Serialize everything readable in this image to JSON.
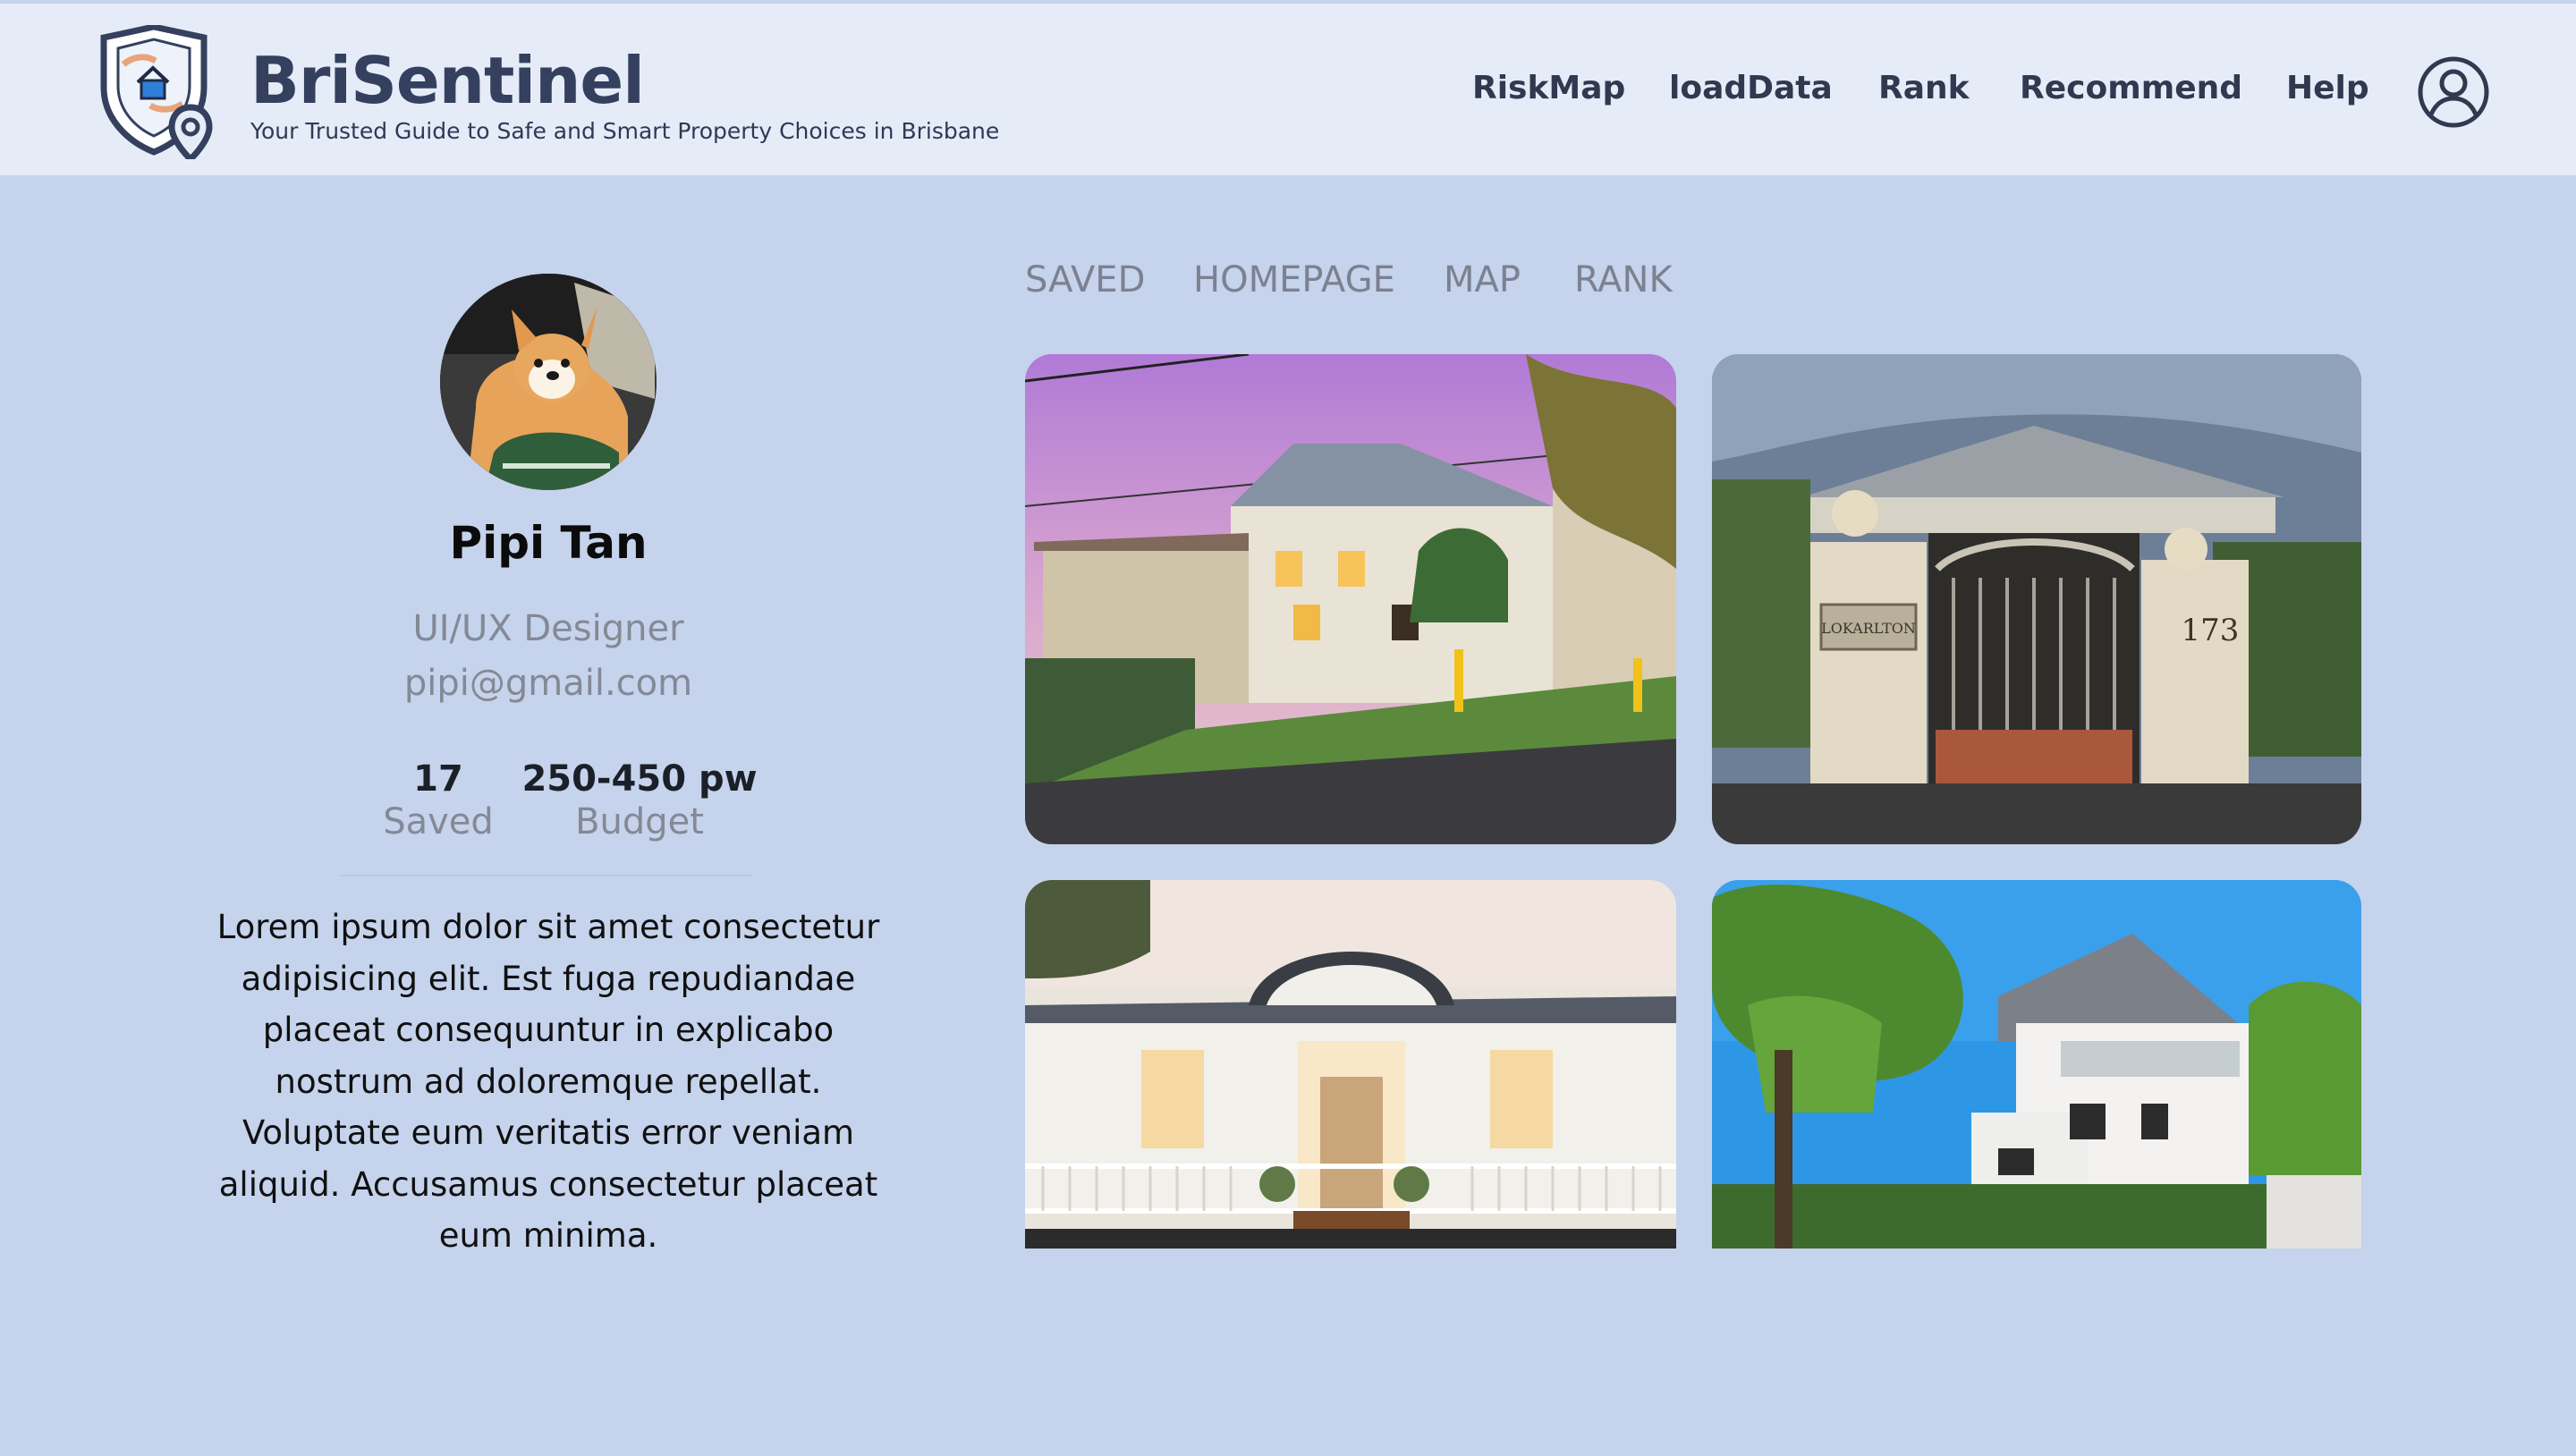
{
  "brand": {
    "title": "BriSentinel",
    "subtitle": "Your Trusted Guide to Safe and Smart Property Choices in Brisbane"
  },
  "nav": {
    "items": [
      {
        "label": "RiskMap"
      },
      {
        "label": "loadData"
      },
      {
        "label": "Rank"
      },
      {
        "label": "Recommend"
      },
      {
        "label": "Help"
      }
    ]
  },
  "profile": {
    "name": "Pipi Tan",
    "role": "UI/UX Designer",
    "email": "pipi@gmail.com",
    "saved_count": "17",
    "saved_label": "Saved",
    "budget_value": "250-450 pw",
    "budget_label": "Budget",
    "bio": "Lorem ipsum dolor sit amet consectetur adipisicing elit. Est fuga repudiandae placeat consequuntur in explicabo nostrum ad doloremque repellat. Voluptate eum veritatis error veniam aliquid. Accusamus consectetur placeat eum minima."
  },
  "tabs": [
    {
      "label": "SAVED"
    },
    {
      "label": "HOMEPAGE"
    },
    {
      "label": "MAP"
    },
    {
      "label": "RANK"
    }
  ],
  "gallery": {
    "house2_sign": "LOKARLTON",
    "house2_number": "173"
  },
  "colors": {
    "page_bg": "#c5d3ec",
    "header_bg": "#e5ecf8",
    "brand": "#34405e",
    "muted": "#838995"
  }
}
